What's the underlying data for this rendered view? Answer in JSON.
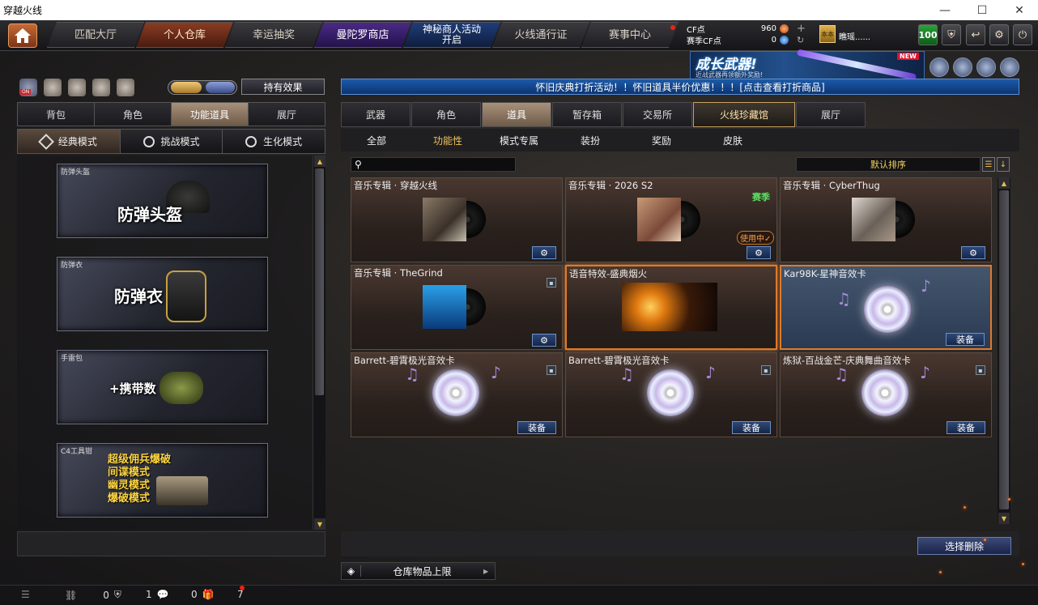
{
  "window": {
    "title": "穿越火线"
  },
  "topnav": {
    "tabs": [
      {
        "label": "匹配大厅"
      },
      {
        "label": "个人仓库"
      },
      {
        "label": "幸运抽奖"
      },
      {
        "label": "曼陀罗商店"
      },
      {
        "label": "神秘商人活动开启"
      },
      {
        "label": "火线通行证"
      },
      {
        "label": "赛事中心"
      }
    ],
    "cf_points_label": "CF点",
    "cf_points_value": "960",
    "season_cf_label": "赛季CF点",
    "season_cf_value": "0",
    "username": "瞧瑶......",
    "rank_badge": "本本",
    "level": "100"
  },
  "banner": {
    "headline": "成长武器!",
    "subline": "近战武器再领额外奖励!",
    "tag": "NEW"
  },
  "left": {
    "effect_button": "持有效果",
    "on_label": "ON",
    "tabs": [
      "背包",
      "角色",
      "功能道具",
      "展厅"
    ],
    "modes": [
      "经典模式",
      "挑战模式",
      "生化模式"
    ],
    "items": [
      {
        "caption": "防弹头盔",
        "text": "防弹头盔"
      },
      {
        "caption": "防弹衣",
        "text": "防弹衣"
      },
      {
        "caption": "手雷包",
        "text": "+携带数"
      },
      {
        "caption": "C4工具钳",
        "lines": [
          "超级佣兵爆破",
          "间谍模式",
          "幽灵模式",
          "爆破模式"
        ]
      }
    ]
  },
  "right": {
    "marquee": "怀旧庆典打折活动！！怀旧道具半价优惠！！！[点击查看打折商品]",
    "tabs": [
      "武器",
      "角色",
      "道具",
      "暂存箱",
      "交易所",
      "火线珍藏馆",
      "展厅"
    ],
    "subtabs": [
      "全部",
      "功能性",
      "模式专属",
      "装扮",
      "奖励",
      "皮肤"
    ],
    "sort_label": "默认排序",
    "items": [
      {
        "title": "音乐专辑 · 穿越火线"
      },
      {
        "title": "音乐专辑 · 2026 S2",
        "badge": "赛季",
        "status": "使用中✓"
      },
      {
        "title": "音乐专辑 · CyberThug"
      },
      {
        "title": "音乐专辑 · TheGrind"
      },
      {
        "title": "语音特效-盛典烟火"
      },
      {
        "title": "Kar98K-星神音效卡",
        "button": "装备"
      },
      {
        "title": "Barrett-碧霄极光音效卡",
        "button": "装备"
      },
      {
        "title": "Barrett-碧霄极光音效卡",
        "button": "装备"
      },
      {
        "title": "炼狱-百战金芒-庆典舞曲音效卡",
        "button": "装备"
      }
    ],
    "delete_button": "选择删除",
    "storage_limit": "仓库物品上限"
  },
  "statusbar": {
    "count1": "0",
    "count2": "1",
    "count3": "0",
    "count4": "7"
  }
}
